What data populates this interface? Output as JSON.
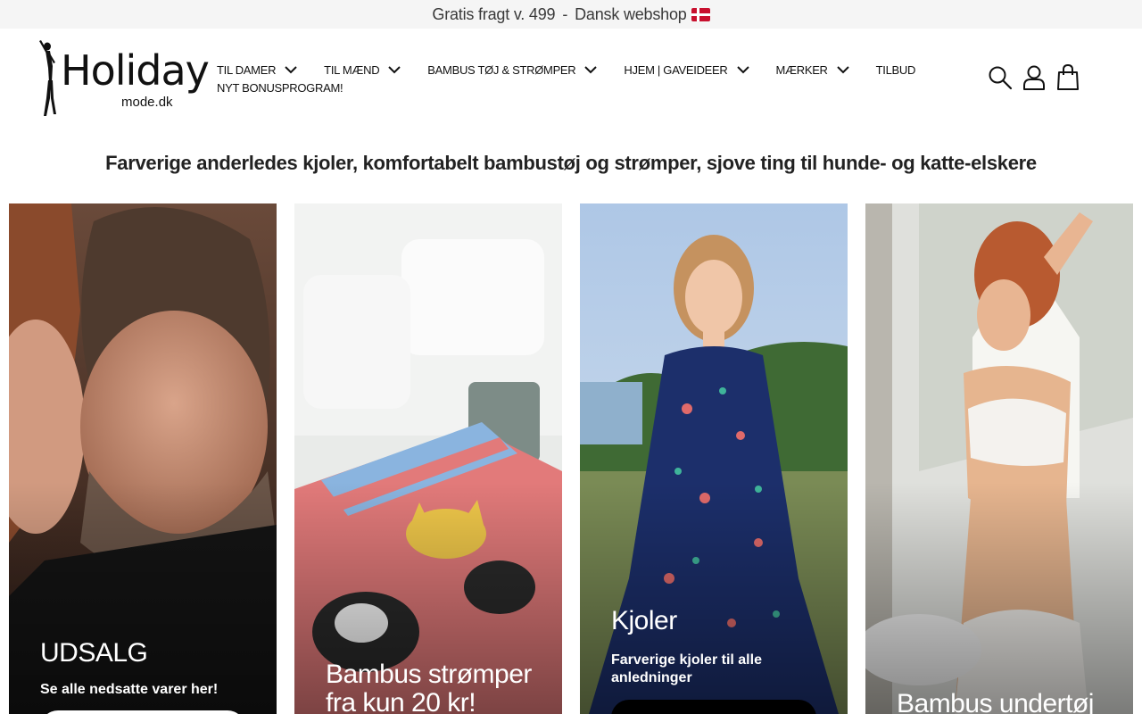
{
  "announcement": {
    "left": "Gratis fragt v. 499",
    "separator": "-",
    "right": "Dansk webshop"
  },
  "logo": {
    "name": "Holiday",
    "sub": "mode.dk"
  },
  "nav": {
    "items": [
      {
        "label": "TIL DAMER",
        "has_dropdown": true
      },
      {
        "label": "TIL MÆND",
        "has_dropdown": true
      },
      {
        "label": "BAMBUS TØJ & STRØMPER",
        "has_dropdown": true
      },
      {
        "label": "HJEM | GAVEIDEER",
        "has_dropdown": true
      },
      {
        "label": "MÆRKER",
        "has_dropdown": true
      },
      {
        "label": "TILBUD",
        "has_dropdown": false
      },
      {
        "label": "NYT BONUSPROGRAM!",
        "has_dropdown": false
      }
    ]
  },
  "header_icons": [
    "search-icon",
    "user-icon",
    "cart-icon"
  ],
  "tagline": "Farverige anderledes kjoler, komfortabelt bambustøj og strømper, sjove ting til hunde- og katte-elskere",
  "cards": [
    {
      "title": "UDSALG",
      "subtitle": "Se alle nedsatte varer her!",
      "image": "couple-portrait",
      "button_color": "#ffffff"
    },
    {
      "title": "Bambus strømper fra kun 20 kr!",
      "subtitle": "",
      "image": "cat-pattern-socks",
      "button_color": ""
    },
    {
      "title": "Kjoler",
      "subtitle": "Farverige kjoler til alle anledninger",
      "image": "woman-in-floral-dress",
      "button_color": "#000000"
    },
    {
      "title": "Bambus undertøj",
      "subtitle": "",
      "image": "woman-in-white-underwear",
      "button_color": ""
    }
  ],
  "colors": {
    "announcement_bg": "#f5f5f5",
    "text": "#111111",
    "card_text": "#ffffff"
  }
}
